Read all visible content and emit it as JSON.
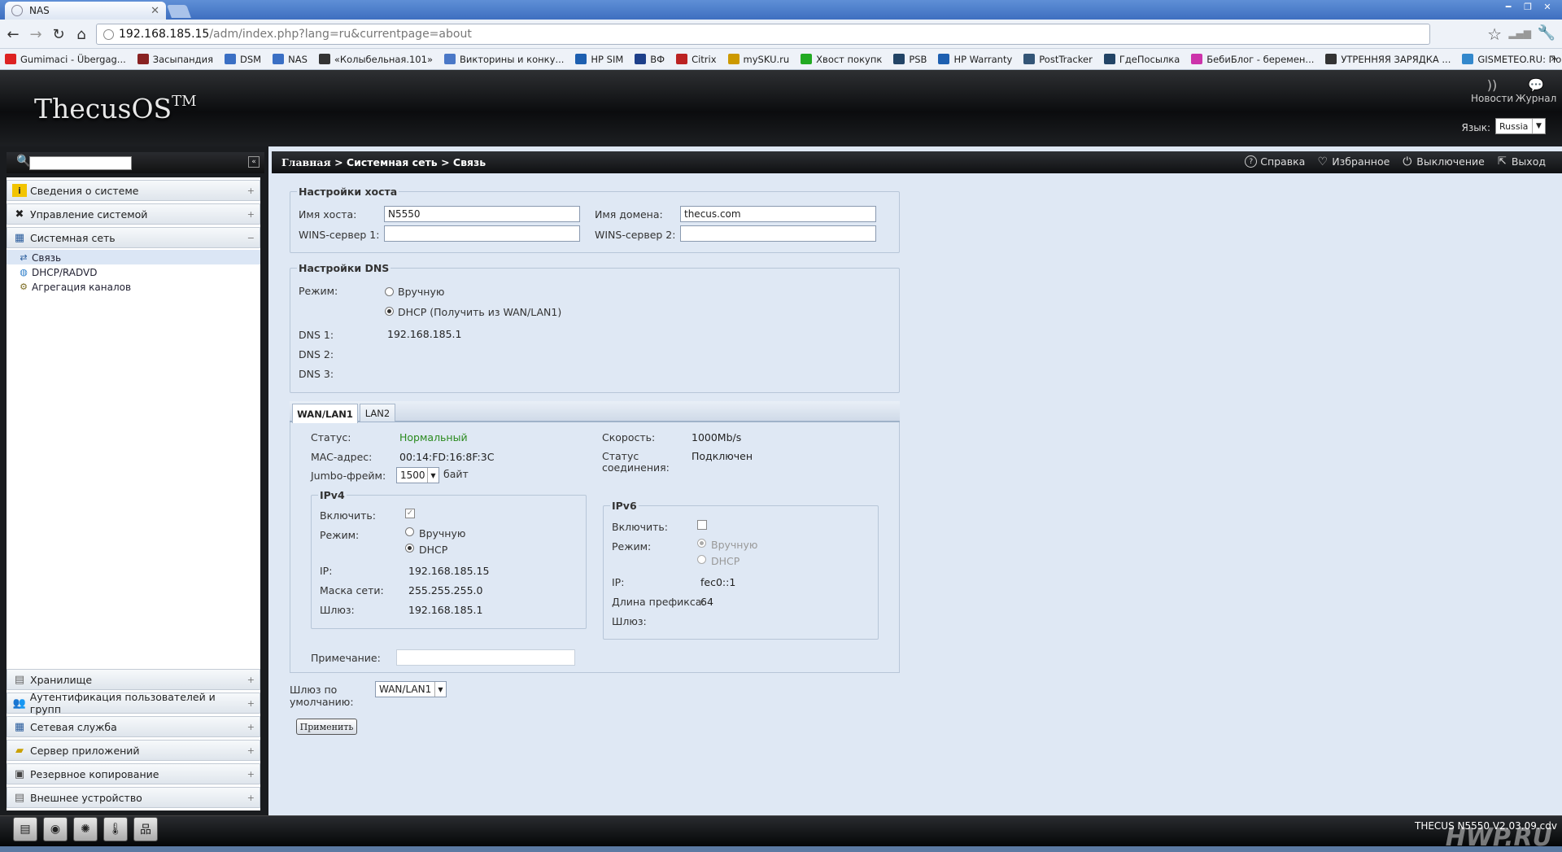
{
  "browser": {
    "tab_title": "NAS",
    "url_host": "192.168.185.15",
    "url_path": "/adm/index.php?lang=ru&currentpage=about",
    "bookmarks": [
      {
        "label": "Gumimaci - Übergag...",
        "color": "#d22"
      },
      {
        "label": "Засыпандия",
        "color": "#822"
      },
      {
        "label": "DSM",
        "color": "#3a6fc4"
      },
      {
        "label": "NAS",
        "color": "#3a6fc4"
      },
      {
        "label": "«Колыбельная.101»",
        "color": "#333"
      },
      {
        "label": "Викторины и конку...",
        "color": "#4a78c7"
      },
      {
        "label": "HP SIM",
        "color": "#1d5fb0"
      },
      {
        "label": "ВФ",
        "color": "#1d3f8a"
      },
      {
        "label": "Citrix",
        "color": "#b22"
      },
      {
        "label": "mySKU.ru",
        "color": "#c90"
      },
      {
        "label": "Хвост покупк",
        "color": "#2a2"
      },
      {
        "label": "PSB",
        "color": "#246"
      },
      {
        "label": "HP Warranty",
        "color": "#1d5fb0"
      },
      {
        "label": "PostTracker",
        "color": "#357"
      },
      {
        "label": "ГдеПосылка",
        "color": "#246"
      },
      {
        "label": "БебиБлог - беремен...",
        "color": "#c3a"
      },
      {
        "label": "УТРЕННЯЯ ЗАРЯДКА ...",
        "color": "#333"
      },
      {
        "label": "GISMETEO.RU: Пого...",
        "color": "#38c"
      }
    ],
    "bookmarks_more": "»"
  },
  "app": {
    "logo_text": "ThecusOS",
    "logo_tm": "TM",
    "news_label": "Новости",
    "log_label": "Журнал",
    "lang_label": "Язык:",
    "lang_value": "Russia"
  },
  "sidebar": {
    "items_top": [
      {
        "label": "Сведения о системе",
        "icon": "info-icon",
        "pm": "+"
      },
      {
        "label": "Управление системой",
        "icon": "tools-icon",
        "pm": "+"
      },
      {
        "label": "Системная сеть",
        "icon": "network-icon",
        "pm": "−"
      }
    ],
    "subitems": [
      {
        "label": "Связь",
        "icon": "link-icon"
      },
      {
        "label": "DHCP/RADVD",
        "icon": "globe-icon"
      },
      {
        "label": "Агрегация каналов",
        "icon": "aggregation-icon"
      }
    ],
    "items_bottom": [
      {
        "label": "Хранилище",
        "icon": "storage-icon",
        "pm": "+"
      },
      {
        "label": "Аутентификация пользователей и групп",
        "icon": "users-icon",
        "pm": "+"
      },
      {
        "label": "Сетевая служба",
        "icon": "service-icon",
        "pm": "+"
      },
      {
        "label": "Сервер приложений",
        "icon": "app-server-icon",
        "pm": "+"
      },
      {
        "label": "Резервное копирование",
        "icon": "backup-icon",
        "pm": "+"
      },
      {
        "label": "Внешнее устройство",
        "icon": "device-icon",
        "pm": "+"
      }
    ]
  },
  "breadcrumb": {
    "home": "Главная",
    "sep": ">",
    "section": "Системная сеть",
    "page": "Связь"
  },
  "toolbar": {
    "help": "Справка",
    "favorites": "Избранное",
    "shutdown": "Выключение",
    "logout": "Выход"
  },
  "host": {
    "legend": "Настройки хоста",
    "hostname_label": "Имя хоста:",
    "hostname_value": "N5550",
    "domain_label": "Имя домена:",
    "domain_value": "thecus.com",
    "wins1_label": "WINS-сервер 1:",
    "wins1_value": "",
    "wins2_label": "WINS-сервер 2:",
    "wins2_value": ""
  },
  "dns": {
    "legend": "Настройки DNS",
    "mode_label": "Режим:",
    "manual_label": "Вручную",
    "dhcp_label": "DHCP (Получить из WAN/LAN1)",
    "dns1_label": "DNS 1:",
    "dns1_value": "192.168.185.1",
    "dns2_label": "DNS 2:",
    "dns3_label": "DNS 3:"
  },
  "tabs": [
    "WAN/LAN1",
    "LAN2"
  ],
  "wan": {
    "status_label": "Статус:",
    "status_value": "Нормальный",
    "mac_label": "MAC-адрес:",
    "mac_value": "00:14:FD:16:8F:3C",
    "jumbo_label": "Jumbo-фрейм:",
    "jumbo_value": "1500",
    "jumbo_unit": "байт",
    "speed_label": "Скорость:",
    "speed_value": "1000Mb/s",
    "conn_label_1": "Статус",
    "conn_label_2": "соединения:",
    "conn_value": "Подключен",
    "note_label": "Примечание:",
    "note_value": ""
  },
  "ipv4": {
    "legend": "IPv4",
    "enable_label": "Включить:",
    "mode_label": "Режим:",
    "manual_label": "Вручную",
    "dhcp_label": "DHCP",
    "ip_label": "IP:",
    "ip_value": "192.168.185.15",
    "mask_label": "Маска сети:",
    "mask_value": "255.255.255.0",
    "gw_label": "Шлюз:",
    "gw_value": "192.168.185.1"
  },
  "ipv6": {
    "legend": "IPv6",
    "enable_label": "Включить:",
    "mode_label": "Режим:",
    "manual_label": "Вручную",
    "dhcp_label": "DHCP",
    "ip_label": "IP:",
    "ip_value": "fec0::1",
    "prefix_label": "Длина префикса:",
    "prefix_value": "64",
    "gw_label": "Шлюз:"
  },
  "gateway": {
    "label_1": "Шлюз по",
    "label_2": "умолчанию:",
    "value": "WAN/LAN1"
  },
  "apply_label": "Применить",
  "footer": {
    "model": "THECUS N5550 V2.03.09.cdv",
    "watermark": "HWP.RU"
  }
}
